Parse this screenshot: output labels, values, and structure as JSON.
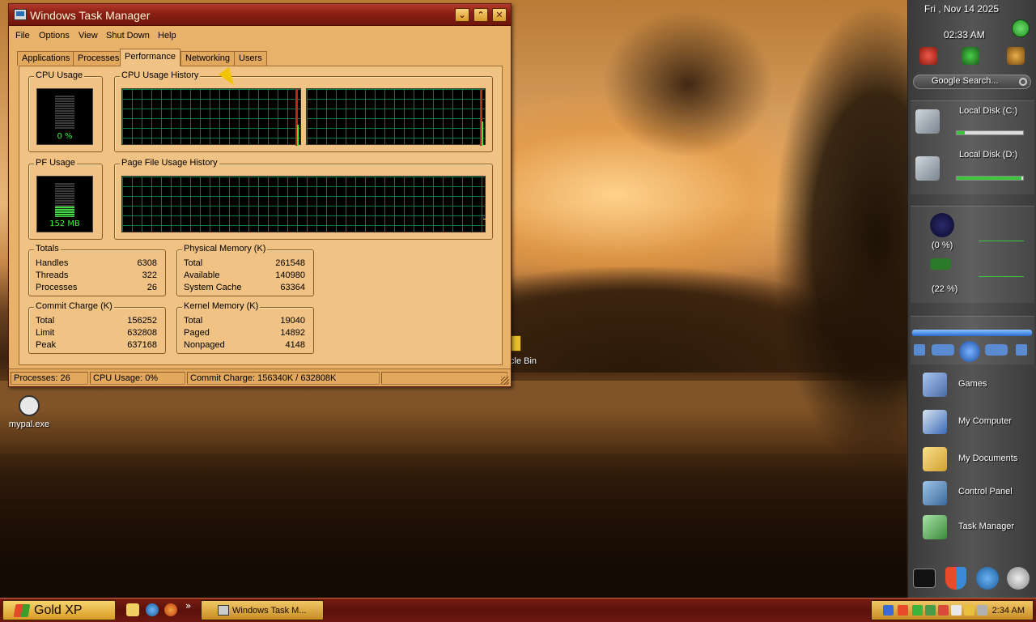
{
  "task_manager": {
    "title": "Windows Task Manager",
    "title_buttons": [
      "⌄",
      "⌃",
      "✕"
    ],
    "menu": [
      "File",
      "Options",
      "View",
      "Shut Down",
      "Help"
    ],
    "tabs": [
      "Applications",
      "Processes",
      "Performance",
      "Networking",
      "Users"
    ],
    "active_tab": "Performance",
    "cpu_usage": {
      "title": "CPU Usage",
      "value": "0 %"
    },
    "cpu_history": {
      "title": "CPU Usage History"
    },
    "pf_usage": {
      "title": "PF Usage",
      "value": "152 MB",
      "fill_fraction": 0.3
    },
    "pf_history": {
      "title": "Page File Usage History"
    },
    "totals": {
      "title": "Totals",
      "rows": [
        {
          "label": "Handles",
          "value": "6308"
        },
        {
          "label": "Threads",
          "value": "322"
        },
        {
          "label": "Processes",
          "value": "26"
        }
      ]
    },
    "physical_memory": {
      "title": "Physical Memory (K)",
      "rows": [
        {
          "label": "Total",
          "value": "261548"
        },
        {
          "label": "Available",
          "value": "140980"
        },
        {
          "label": "System Cache",
          "value": "63364"
        }
      ]
    },
    "commit_charge": {
      "title": "Commit Charge (K)",
      "rows": [
        {
          "label": "Total",
          "value": "156252"
        },
        {
          "label": "Limit",
          "value": "632808"
        },
        {
          "label": "Peak",
          "value": "637168"
        }
      ]
    },
    "kernel_memory": {
      "title": "Kernel Memory (K)",
      "rows": [
        {
          "label": "Total",
          "value": "19040"
        },
        {
          "label": "Paged",
          "value": "14892"
        },
        {
          "label": "Nonpaged",
          "value": "4148"
        }
      ]
    },
    "status_bar": {
      "processes": "Processes: 26",
      "cpu": "CPU Usage: 0%",
      "commit": "Commit Charge: 156340K / 632808K"
    }
  },
  "desktop": {
    "icons": [
      {
        "label": "mypal.exe"
      },
      {
        "label": "cle Bin"
      }
    ]
  },
  "sidebar": {
    "date": "Fri , Nov 14 2025",
    "clock": "02:33 AM",
    "search_placeholder": "Google Search...",
    "drives": [
      {
        "label": "Local Disk (C:)",
        "fill_fraction": 0.12
      },
      {
        "label": "Local Disk (D:)",
        "fill_fraction": 0.98
      }
    ],
    "meters": [
      {
        "value": "(0 %)"
      },
      {
        "value": "(22 %)"
      }
    ],
    "launchers": [
      "Games",
      "My Computer",
      "My Documents",
      "Control Panel",
      "Task Manager"
    ]
  },
  "taskbar": {
    "start_label": "Gold XP",
    "window_button": "Windows Task M...",
    "tray_time": "2:34 AM",
    "quick_launch_more": "»"
  },
  "colors": {
    "title_bar": "#8a1f14",
    "window_body": "#f0c283",
    "graph_grid": "#0a7a40",
    "meter_green": "#37f237",
    "taskbar": "#6e180f"
  }
}
